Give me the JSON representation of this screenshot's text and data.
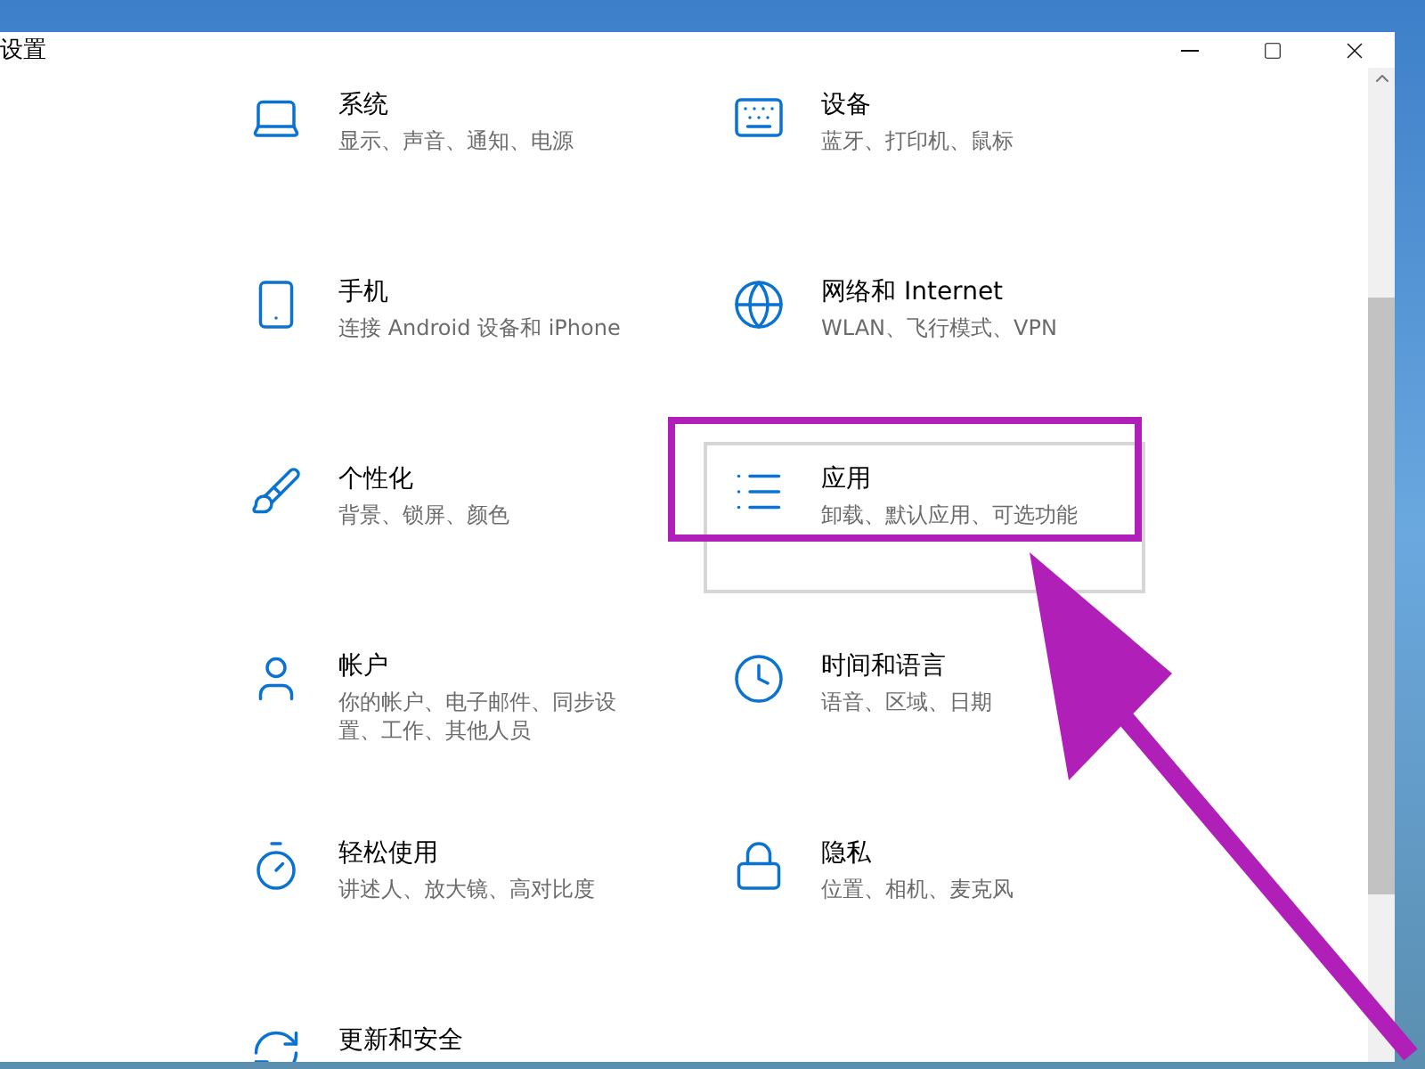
{
  "window": {
    "title": "设置"
  },
  "tiles": [
    {
      "title": "系统",
      "subtitle": "显示、声音、通知、电源",
      "hovered": false
    },
    {
      "title": "设备",
      "subtitle": "蓝牙、打印机、鼠标",
      "hovered": false
    },
    {
      "title": "手机",
      "subtitle": "连接 Android 设备和 iPhone",
      "hovered": false
    },
    {
      "title": "网络和 Internet",
      "subtitle": "WLAN、飞行模式、VPN",
      "hovered": false
    },
    {
      "title": "个性化",
      "subtitle": "背景、锁屏、颜色",
      "hovered": false
    },
    {
      "title": "应用",
      "subtitle": "卸载、默认应用、可选功能",
      "hovered": true
    },
    {
      "title": "帐户",
      "subtitle": "你的帐户、电子邮件、同步设置、工作、其他人员",
      "hovered": false
    },
    {
      "title": "时间和语言",
      "subtitle": "语音、区域、日期",
      "hovered": false
    },
    {
      "title": "轻松使用",
      "subtitle": "讲述人、放大镜、高对比度",
      "hovered": false
    },
    {
      "title": "隐私",
      "subtitle": "位置、相机、麦克风",
      "hovered": false
    },
    {
      "title": "更新和安全",
      "hovered": false
    }
  ]
}
